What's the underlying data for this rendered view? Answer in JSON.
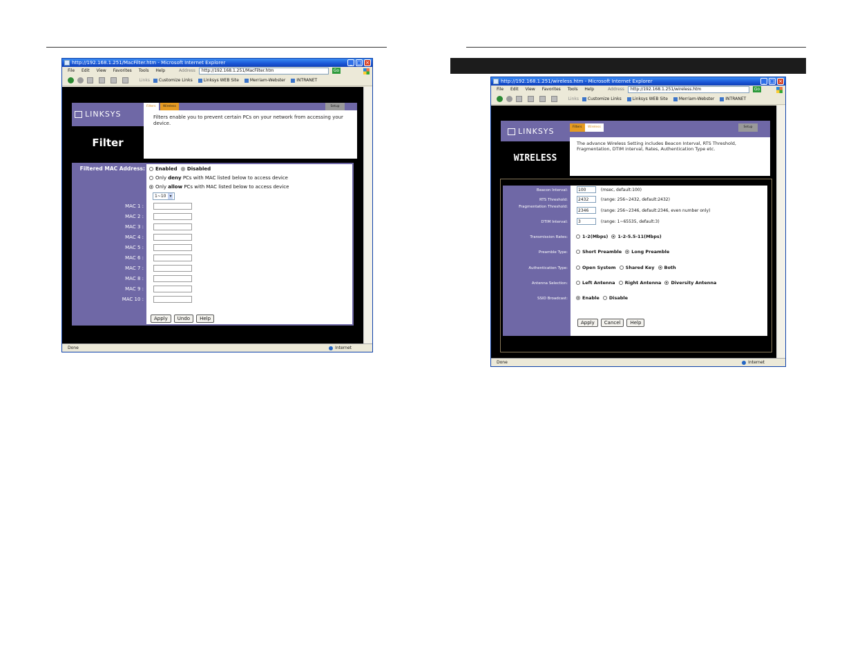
{
  "left": {
    "window": {
      "title": "http://192.168.1.251/MacFilter.htm - Microsoft Internet Explorer",
      "menu": [
        "File",
        "Edit",
        "View",
        "Favorites",
        "Tools",
        "Help"
      ],
      "address_label": "Address",
      "address_value": "http://192.168.1.251/MacFilter.htm",
      "go_label": "Go",
      "links_label": "Links",
      "links": [
        "Customize Links",
        "Linksys WEB Site",
        "Merriam-Webster",
        "INTRANET"
      ],
      "status": "Done",
      "zone": "Internet"
    },
    "page": {
      "logo": "LINKSYS",
      "tabs": [
        "Filters",
        "Wireless"
      ],
      "help_tab": "Setup",
      "title": "Filter",
      "description": "Filters enable you to prevent certain PCs on your network from accessing your device.",
      "filtered_label": "Filtered MAC Address:",
      "enabled_label": "Enabled",
      "disabled_label": "Disabled",
      "deny_pre": "Only",
      "deny_word": "deny",
      "deny_post": "PCs with MAC listed below to access device",
      "allow_pre": "Only",
      "allow_word": "allow",
      "allow_post": "PCs with MAC listed below to access device",
      "range_select": "1~10",
      "mac_labels": [
        "MAC 1 :",
        "MAC 2 :",
        "MAC 3 :",
        "MAC 4 :",
        "MAC 5 :",
        "MAC 6 :",
        "MAC 7 :",
        "MAC 8 :",
        "MAC 9 :",
        "MAC 10 :"
      ],
      "buttons": [
        "Apply",
        "Undo",
        "Help"
      ]
    }
  },
  "right": {
    "window": {
      "title": "http://192.168.1.251/wireless.htm - Microsoft Internet Explorer",
      "menu": [
        "File",
        "Edit",
        "View",
        "Favorites",
        "Tools",
        "Help"
      ],
      "address_label": "Address",
      "address_value": "http://192.168.1.251/wireless.htm",
      "go_label": "Go",
      "links_label": "Links",
      "links": [
        "Customize Links",
        "Linksys WEB Site",
        "Merriam-Webster",
        "INTRANET"
      ],
      "status": "Done",
      "zone": "Internet"
    },
    "page": {
      "logo": "LINKSYS",
      "tabs": [
        "Filters",
        "Wireless"
      ],
      "help_tab": "Setup",
      "title": "WIRELESS",
      "description": "The advance Wireless Setting includes Beacon Interval, RTS Threshold, Fragmentation, DTIM interval, Rates, Authentication Type etc.",
      "beacon_label": "Beacon Interval:",
      "beacon_value": "100",
      "beacon_hint": "(msec, default:100)",
      "rts_label": "RTS Threshold:",
      "rts_value": "2432",
      "rts_hint": "(range: 256~2432, default:2432)",
      "frag_label": "Fragmentation Threshold:",
      "frag_value": "2346",
      "frag_hint": "(range: 256~2346, default:2346, even number only)",
      "dtim_label": "DTIM Interval:",
      "dtim_value": "3",
      "dtim_hint": "(range: 1~65535, default:3)",
      "rate_label": "Transmission Rates:",
      "rate_opt1": "1-2(Mbps)",
      "rate_opt2": "1-2-5.5-11(Mbps)",
      "preamble_label": "Preamble Type:",
      "preamble_opt1": "Short Preamble",
      "preamble_opt2": "Long Preamble",
      "auth_label": "Authentication Type:",
      "auth_opt1": "Open System",
      "auth_opt2": "Shared Key",
      "auth_opt3": "Both",
      "antenna_label": "Antenna Selection:",
      "antenna_opt1": "Left Antenna",
      "antenna_opt2": "Right Antenna",
      "antenna_opt3": "Diversity Antenna",
      "ssid_label": "SSID Broadcast:",
      "ssid_opt1": "Enable",
      "ssid_opt2": "Disable",
      "buttons": [
        "Apply",
        "Cancel",
        "Help"
      ]
    }
  }
}
